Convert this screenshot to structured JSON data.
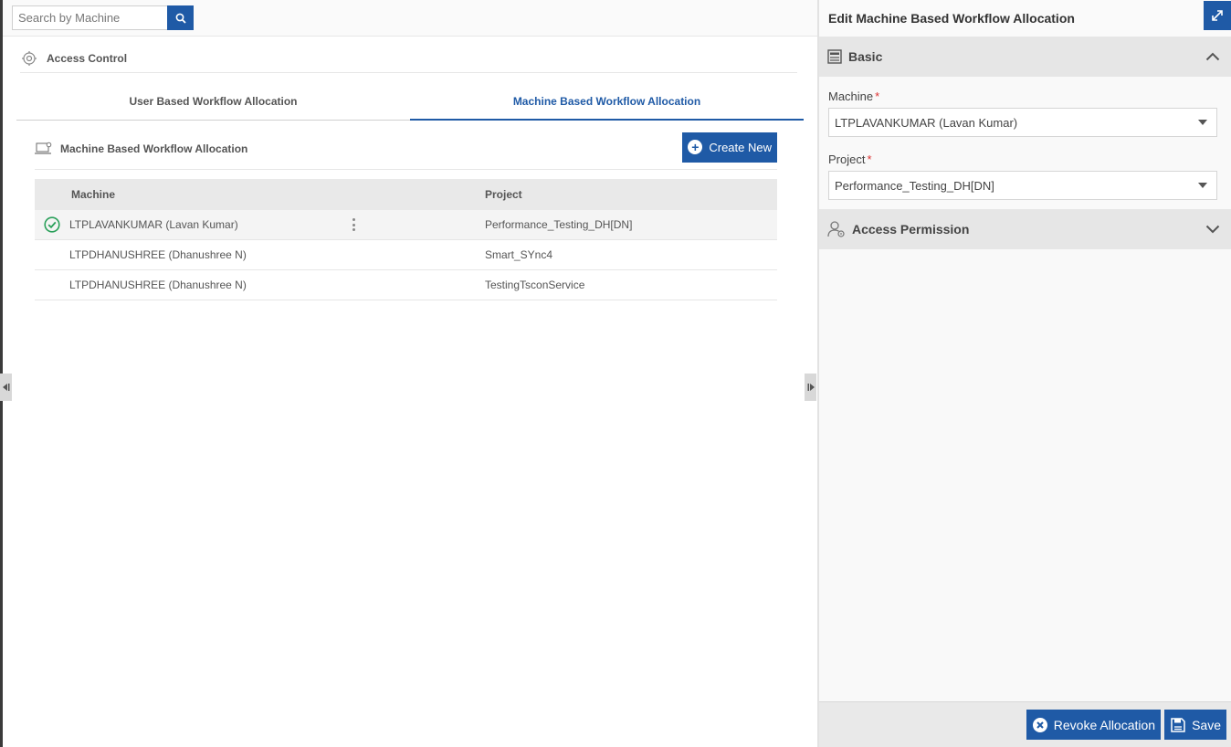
{
  "search": {
    "placeholder": "Search by Machine"
  },
  "access_control": {
    "title": "Access Control"
  },
  "tabs": [
    {
      "label": "User Based Workflow Allocation",
      "active": false
    },
    {
      "label": "Machine Based Workflow Allocation",
      "active": true
    }
  ],
  "section": {
    "title": "Machine Based Workflow Allocation",
    "create_label": "Create New"
  },
  "grid": {
    "columns": {
      "machine": "Machine",
      "project": "Project"
    },
    "rows": [
      {
        "machine": "LTPLAVANKUMAR (Lavan Kumar)",
        "project": "Performance_Testing_DH[DN]",
        "selected": true
      },
      {
        "machine": "LTPDHANUSHREE (Dhanushree N)",
        "project": "Smart_SYnc4",
        "selected": false
      },
      {
        "machine": "LTPDHANUSHREE (Dhanushree N)",
        "project": "TestingTsconService",
        "selected": false
      }
    ]
  },
  "panel": {
    "title": "Edit Machine Based Workflow Allocation",
    "basic": {
      "title": "Basic",
      "machine_label": "Machine",
      "machine_value": "LTPLAVANKUMAR (Lavan Kumar)",
      "project_label": "Project",
      "project_value": "Performance_Testing_DH[DN]",
      "required_mark": "*"
    },
    "access_permission": {
      "title": "Access Permission"
    },
    "footer": {
      "revoke_label": "Revoke Allocation",
      "save_label": "Save"
    }
  },
  "colors": {
    "accent": "#1f5aa6",
    "success": "#2aa05a",
    "required": "#d33333"
  }
}
